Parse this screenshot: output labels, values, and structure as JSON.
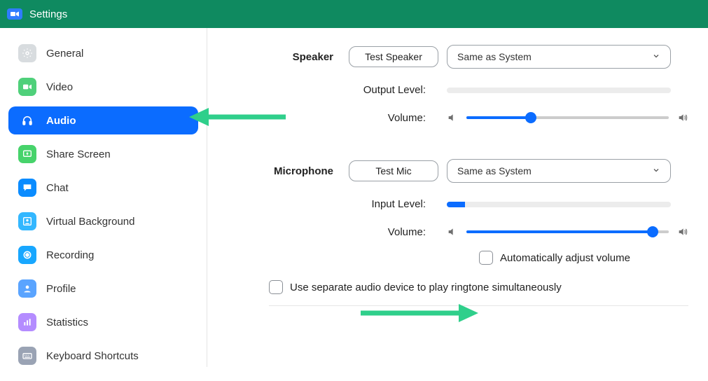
{
  "titlebar": {
    "title": "Settings"
  },
  "sidebar": {
    "items": [
      {
        "label": "General"
      },
      {
        "label": "Video"
      },
      {
        "label": "Audio"
      },
      {
        "label": "Share Screen"
      },
      {
        "label": "Chat"
      },
      {
        "label": "Virtual Background"
      },
      {
        "label": "Recording"
      },
      {
        "label": "Profile"
      },
      {
        "label": "Statistics"
      },
      {
        "label": "Keyboard Shortcuts"
      }
    ]
  },
  "speaker": {
    "heading": "Speaker",
    "test_button": "Test Speaker",
    "device": "Same as System",
    "output_label": "Output Level:",
    "output_percent": 0,
    "volume_label": "Volume:",
    "volume_percent": 32
  },
  "microphone": {
    "heading": "Microphone",
    "test_button": "Test Mic",
    "device": "Same as System",
    "input_label": "Input Level:",
    "input_percent": 8,
    "volume_label": "Volume:",
    "volume_percent": 92,
    "auto_adjust_label": "Automatically adjust volume",
    "auto_adjust_checked": false
  },
  "options": {
    "separate_ringtone_label": "Use separate audio device to play ringtone simultaneously",
    "separate_ringtone_checked": false
  },
  "colors": {
    "accent": "#0b6cff",
    "titlebar": "#0f8a60",
    "arrow": "#2fcf8b"
  }
}
